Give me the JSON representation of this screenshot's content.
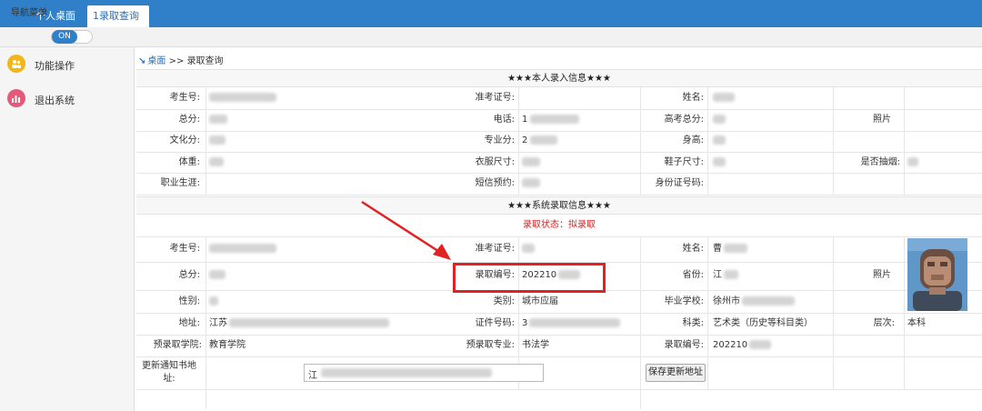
{
  "tabs": [
    {
      "label": "个人桌面"
    },
    {
      "label": "1录取查询",
      "close": "×"
    }
  ],
  "nav": {
    "label": "导航菜单",
    "toggle": "ON"
  },
  "sidebar": {
    "items": [
      {
        "label": "功能操作",
        "icon": "users-icon"
      },
      {
        "label": "退出系统",
        "icon": "chart-icon"
      }
    ]
  },
  "breadcrumb": {
    "arrow": "↘",
    "home": "桌面",
    "sep": ">>",
    "current": "录取查询"
  },
  "section1": {
    "title": "★★★本人录入信息★★★",
    "labels": {
      "exam_no": "考生号:",
      "admit_card": "准考证号:",
      "name": "姓名:",
      "total": "总分:",
      "phone": "电话:",
      "gaokao_total": "高考总分:",
      "photo": "照片",
      "culture": "文化分:",
      "major_score": "专业分:",
      "height": "身高:",
      "weight": "体重:",
      "clothes": "衣服尺寸:",
      "shoes": "鞋子尺寸:",
      "smoke": "是否抽烟:",
      "career": "职业生涯:",
      "sms": "短信预约:",
      "id_no": "身份证号码:"
    },
    "values": {
      "phone": "1",
      "major_score": "2"
    }
  },
  "section2": {
    "title": "★★★系统录取信息★★★",
    "status": "录取状态：拟录取",
    "labels": {
      "exam_no": "考生号:",
      "admit_card": "准考证号:",
      "name": "姓名:",
      "total": "总分:",
      "admit_no": "录取编号:",
      "province": "省份:",
      "photo": "照片",
      "gender": "性别:",
      "category": "类别:",
      "school": "毕业学校:",
      "address": "地址:",
      "id_no": "证件号码:",
      "subject": "科类:",
      "level": "层次:",
      "college": "预录取学院:",
      "major": "预录取专业:",
      "admit_no2": "录取编号:",
      "update_addr": "更新通知书地址:"
    },
    "values": {
      "name": "曹",
      "admit_no": "202210",
      "province": "江",
      "category": "城市应届",
      "school": "徐州市",
      "address": "江苏",
      "id_no": "3",
      "subject": "艺术类（历史等科目类）",
      "level": "本科",
      "college": "教育学院",
      "major": "书法学",
      "admit_no2": "202210",
      "addr_input": "江"
    },
    "save_button": "保存更新地址"
  },
  "colors": {
    "topbar": "#2f80c9",
    "highlight": "#e02222",
    "status": "#d92020"
  }
}
